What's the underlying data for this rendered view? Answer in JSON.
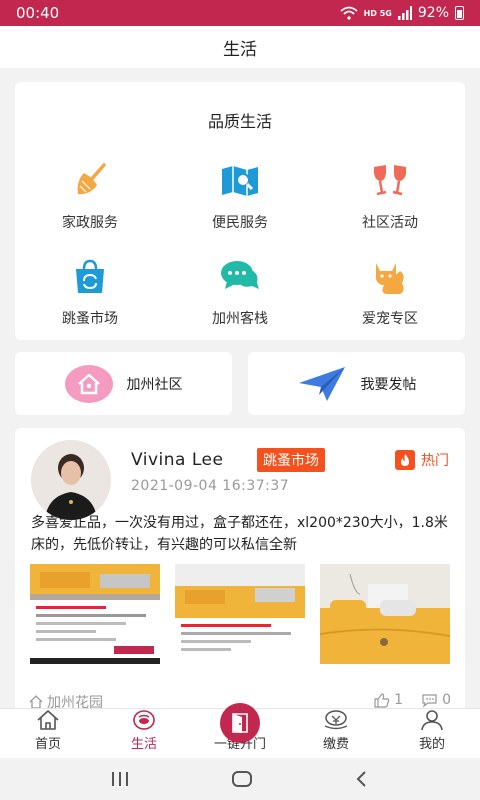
{
  "status": {
    "time": "00:40",
    "network": "HD 5G",
    "battery": "92%"
  },
  "header": {
    "title": "生活"
  },
  "quality": {
    "title": "品质生活",
    "items": [
      {
        "label": "家政服务",
        "icon": "broom-icon"
      },
      {
        "label": "便民服务",
        "icon": "map-icon"
      },
      {
        "label": "社区活动",
        "icon": "wine-glasses-icon"
      },
      {
        "label": "跳蚤市场",
        "icon": "shopping-bag-icon"
      },
      {
        "label": "加州客栈",
        "icon": "chat-bubble-icon"
      },
      {
        "label": "爱宠专区",
        "icon": "cat-icon"
      }
    ]
  },
  "quick": {
    "community": "加州社区",
    "post": "我要发帖"
  },
  "post": {
    "author": "Vivina Lee",
    "tag": "跳蚤市场",
    "hot": "热门",
    "time": "2021-09-04 16:37:37",
    "content": "多喜爱正品，一次没有用过，盒子都还在，xl200*230大小，1.8米床的，先低价转让，有兴趣的可以私信全新",
    "location": "加州花园",
    "likes": "1",
    "comments": "0"
  },
  "tabs": [
    {
      "label": "首页"
    },
    {
      "label": "生活"
    },
    {
      "label": "一键开门"
    },
    {
      "label": "缴费"
    },
    {
      "label": "我的"
    }
  ],
  "colors": {
    "accent": "#c2284f",
    "tag": "#f4511e",
    "icon_blue": "#1e9ad6",
    "icon_teal": "#22b9a8",
    "icon_orange": "#f5a742",
    "icon_red": "#ef6b57"
  }
}
